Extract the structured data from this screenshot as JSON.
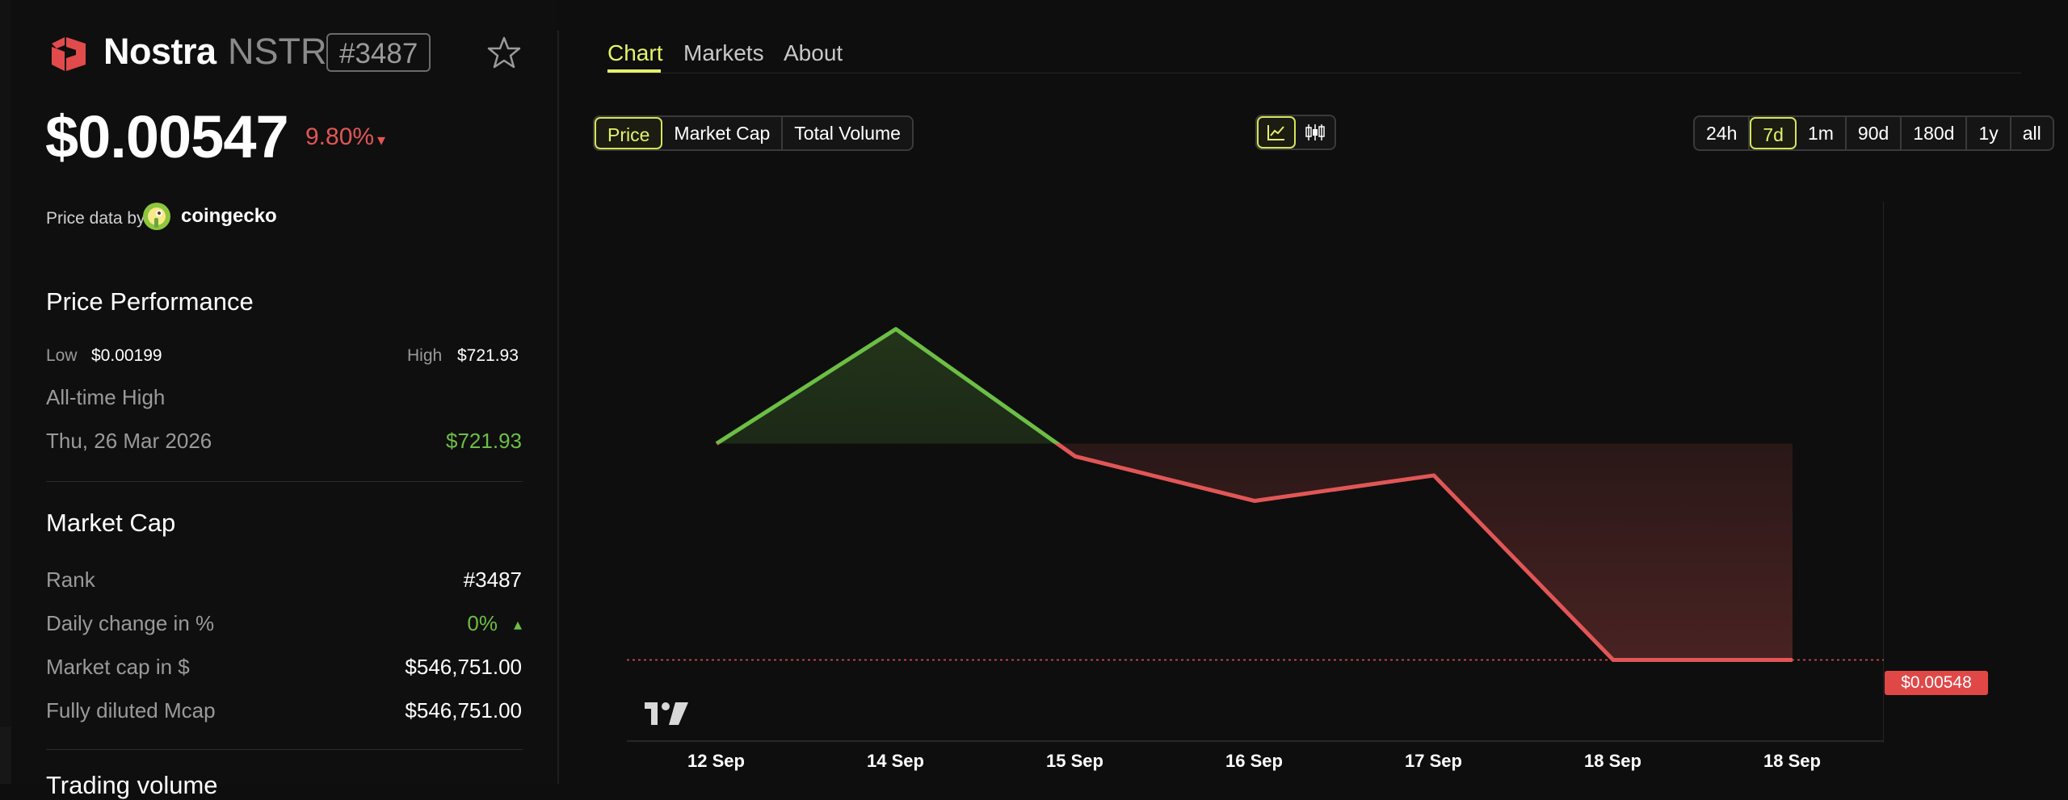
{
  "coin": {
    "name": "Nostra",
    "ticker": "NSTR",
    "rank_badge": "#3487"
  },
  "price": {
    "value": "$0.00547",
    "change": "9.80%",
    "change_arrow": "▾"
  },
  "price_data": {
    "label": "Price data by",
    "provider": "coingecko"
  },
  "performance": {
    "title": "Price Performance",
    "low_label": "Low",
    "low_value": "$0.00199",
    "high_label": "High",
    "high_value": "$721.93",
    "ath_label": "All-time High",
    "ath_date": "Thu, 26 Mar 2026",
    "ath_value": "$721.93"
  },
  "market_cap": {
    "title": "Market Cap",
    "rows": [
      {
        "label": "Rank",
        "value": "#3487"
      },
      {
        "label": "Daily change in %",
        "value": "0%",
        "arrow": "▴"
      },
      {
        "label": "Market cap in $",
        "value": "$546,751.00"
      },
      {
        "label": "Fully diluted Mcap",
        "value": "$546,751.00"
      }
    ],
    "next_section_partial": "Trading volume"
  },
  "tabs": {
    "chart": "Chart",
    "markets": "Markets",
    "about": "About"
  },
  "metric_toggle": {
    "price": "Price",
    "market_cap": "Market Cap",
    "total_volume": "Total Volume"
  },
  "chart_type_icons": {
    "line": "line-chart-icon",
    "candle": "candlestick-icon"
  },
  "ranges": [
    "24h",
    "7d",
    "1m",
    "90d",
    "180d",
    "1y",
    "all"
  ],
  "selected_range": "7d",
  "colors": {
    "accent": "#e4f26b",
    "up": "#6cbe45",
    "down": "#e15656",
    "background": "#0e0e0e"
  },
  "current_price_tag": "$0.00548",
  "chart_data": {
    "type": "line",
    "x": [
      "12 Sep",
      "14 Sep",
      "15 Sep",
      "16 Sep",
      "17 Sep",
      "18 Sep",
      "18 Sep"
    ],
    "series": [
      {
        "values": [
          0.00582,
          0.006,
          0.0058,
          0.00573,
          0.00577,
          0.00548,
          0.00548
        ]
      }
    ],
    "baseline": 0.00582,
    "ylim": [
      0.00535,
      0.0062
    ],
    "grid": false,
    "current_value_label": "$0.00548"
  }
}
